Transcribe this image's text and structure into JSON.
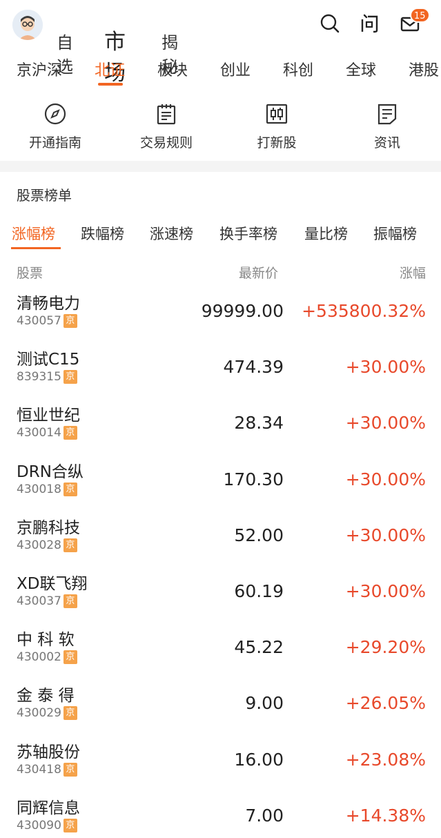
{
  "header": {
    "nav": [
      "自选",
      "市场",
      "揭秘"
    ],
    "badge_count": "15",
    "icons": [
      "avatar",
      "search-icon",
      "question-icon",
      "mail-icon"
    ]
  },
  "market_tabs": [
    "京沪深",
    "北证",
    "板块",
    "创业",
    "科创",
    "全球",
    "港股"
  ],
  "market_tabs_active": "北证",
  "shortcuts": [
    {
      "label": "开通指南",
      "icon": "compass-icon"
    },
    {
      "label": "交易规则",
      "icon": "rules-icon"
    },
    {
      "label": "打新股",
      "icon": "candlestick-icon"
    },
    {
      "label": "资讯",
      "icon": "news-icon"
    }
  ],
  "section_title": "股票榜单",
  "rank_tabs": [
    "涨幅榜",
    "跌幅榜",
    "涨速榜",
    "换手率榜",
    "量比榜",
    "振幅榜"
  ],
  "rank_tabs_active": "涨幅榜",
  "table": {
    "headers": {
      "stock": "股票",
      "price": "最新价",
      "change": "涨幅"
    },
    "exchange_tag": "京",
    "rows": [
      {
        "name": "清畅电力",
        "code": "430057",
        "price": "99999.00",
        "change": "+535800.32%"
      },
      {
        "name": "测试C15",
        "code": "839315",
        "price": "474.39",
        "change": "+30.00%"
      },
      {
        "name": "恒业世纪",
        "code": "430014",
        "price": "28.34",
        "change": "+30.00%"
      },
      {
        "name": "DRN合纵",
        "code": "430018",
        "price": "170.30",
        "change": "+30.00%"
      },
      {
        "name": "京鹏科技",
        "code": "430028",
        "price": "52.00",
        "change": "+30.00%"
      },
      {
        "name": "XD联飞翔",
        "code": "430037",
        "price": "60.19",
        "change": "+30.00%"
      },
      {
        "name": "中 科 软",
        "code": "430002",
        "price": "45.22",
        "change": "+29.20%"
      },
      {
        "name": "金 泰 得",
        "code": "430029",
        "price": "9.00",
        "change": "+26.05%"
      },
      {
        "name": "苏轴股份",
        "code": "430418",
        "price": "16.00",
        "change": "+23.08%"
      },
      {
        "name": "同辉信息",
        "code": "430090",
        "price": "7.00",
        "change": "+14.38%"
      }
    ]
  },
  "colors": {
    "accent": "#f26522",
    "up": "#e8492b",
    "tag": "#f5a24a"
  }
}
